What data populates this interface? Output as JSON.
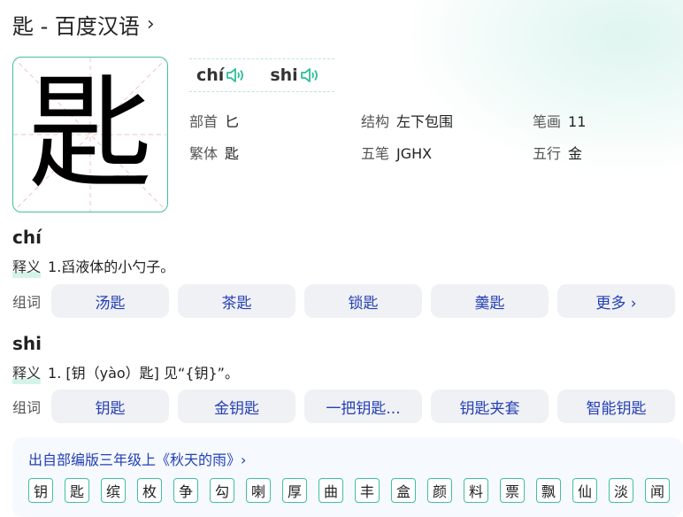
{
  "page": {
    "title": "匙 - 百度汉语",
    "title_chevron": "›"
  },
  "character": {
    "glyph": "匙",
    "pinyin": [
      "chí",
      "shi"
    ]
  },
  "info": {
    "bushou_label": "部首",
    "bushou": "匕",
    "jiegou_label": "结构",
    "jiegou": "左下包围",
    "bihua_label": "笔画",
    "bihua": "11",
    "fanti_label": "繁体",
    "fanti": "匙",
    "wubi_label": "五笔",
    "wubi": "JGHX",
    "wuxing_label": "五行",
    "wuxing": "金"
  },
  "sections": [
    {
      "pinyin": "chí",
      "def_label": "释义",
      "definition": "1.舀液体的小勺子。",
      "words_label": "组词",
      "words": [
        "汤匙",
        "茶匙",
        "锁匙",
        "羹匙",
        "更多 ›"
      ]
    },
    {
      "pinyin": "shi",
      "def_label": "释义",
      "definition": "1. [钥（yào）匙] 见“{钥}”。",
      "words_label": "组词",
      "words": [
        "钥匙",
        "金钥匙",
        "一把钥匙...",
        "钥匙夹套",
        "智能钥匙"
      ]
    }
  ],
  "source": {
    "link": "出自部编版三年级上《秋天的雨》›",
    "chars": [
      "钥",
      "匙",
      "缤",
      "枚",
      "争",
      "勾",
      "喇",
      "厚",
      "曲",
      "丰",
      "盒",
      "颜",
      "料",
      "票",
      "飘",
      "仙",
      "淡",
      "闻"
    ]
  },
  "colors": {
    "accent": "#40c0a0",
    "link": "#2440b3",
    "chip_bg": "#f0f1f5"
  },
  "icons": [
    "speaker-icon",
    "chevron-right-icon"
  ]
}
